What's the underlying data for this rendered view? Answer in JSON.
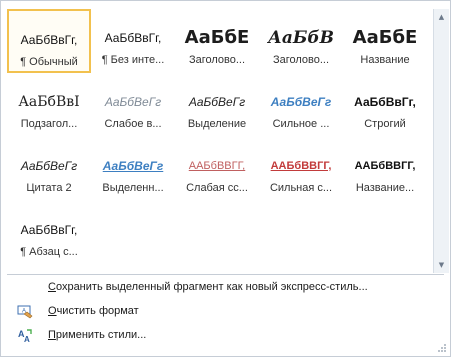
{
  "styles": [
    {
      "sample": "АаБбВвГг,",
      "caption": "¶ Обычный",
      "font": "\"Liberation Sans\", sans-serif",
      "size": "12px",
      "weight": "normal",
      "style": "normal",
      "color": "#111111",
      "decor": "none",
      "selected": true
    },
    {
      "sample": "АаБбВвГг,",
      "caption": "¶ Без инте...",
      "font": "\"Liberation Sans\", sans-serif",
      "size": "12px",
      "weight": "normal",
      "style": "normal",
      "color": "#111111",
      "decor": "none",
      "selected": false
    },
    {
      "sample": "АаБбЕ",
      "caption": "Заголово...",
      "font": "\"DejaVu Sans\", sans-serif",
      "size": "18px",
      "weight": "bold",
      "style": "normal",
      "color": "#1d1d1d",
      "decor": "none",
      "selected": false
    },
    {
      "sample": "АаБбВ",
      "caption": "Заголово...",
      "font": "\"DejaVu Serif\", serif",
      "size": "17px",
      "weight": "bold",
      "style": "italic",
      "color": "#1d1d1d",
      "decor": "none",
      "selected": false
    },
    {
      "sample": "АаБбЕ",
      "caption": "Название",
      "font": "\"DejaVu Sans\", sans-serif",
      "size": "18px",
      "weight": "bold",
      "style": "normal",
      "color": "#1d1d1d",
      "decor": "none",
      "selected": false
    },
    {
      "sample": "АаБбВвI",
      "caption": "Подзагол...",
      "font": "\"DejaVu Serif\", serif",
      "size": "14px",
      "weight": "normal",
      "style": "normal",
      "color": "#222222",
      "decor": "none",
      "selected": false
    },
    {
      "sample": "АаБбВеГг",
      "caption": "Слабое в...",
      "font": "\"Liberation Sans\", sans-serif",
      "size": "12px",
      "weight": "normal",
      "style": "italic",
      "color": "#7f8a96",
      "decor": "none",
      "selected": false
    },
    {
      "sample": "АаБбВеГг",
      "caption": "Выделение",
      "font": "\"Liberation Sans\", sans-serif",
      "size": "12px",
      "weight": "normal",
      "style": "italic",
      "color": "#222222",
      "decor": "none",
      "selected": false
    },
    {
      "sample": "АаБбВеГг",
      "caption": "Сильное ...",
      "font": "\"Liberation Sans\", sans-serif",
      "size": "12px",
      "weight": "bold",
      "style": "italic",
      "color": "#3d7fc1",
      "decor": "none",
      "selected": false
    },
    {
      "sample": "АаБбВвГг,",
      "caption": "Строгий",
      "font": "\"Liberation Sans\", sans-serif",
      "size": "12px",
      "weight": "bold",
      "style": "normal",
      "color": "#111111",
      "decor": "none",
      "selected": false
    },
    {
      "sample": "АаБбВеГг",
      "caption": "Цитата 2",
      "font": "\"Liberation Sans\", sans-serif",
      "size": "12px",
      "weight": "normal",
      "style": "italic",
      "color": "#1d1d1d",
      "decor": "none",
      "selected": false
    },
    {
      "sample": "АаБбВеГг",
      "caption": "Выделенн...",
      "font": "\"Liberation Sans\", sans-serif",
      "size": "12px",
      "weight": "bold",
      "style": "italic",
      "color": "#3d7fc1",
      "decor": "underline",
      "selected": false
    },
    {
      "sample": "ААБбВВГГ,",
      "caption": "Слабая сс...",
      "font": "\"Liberation Sans\", sans-serif",
      "size": "11px",
      "weight": "normal",
      "style": "normal",
      "color": "#c06060",
      "decor": "underline",
      "selected": false
    },
    {
      "sample": "ААБбВВГГ,",
      "caption": "Сильная с...",
      "font": "\"Liberation Sans\", sans-serif",
      "size": "11px",
      "weight": "bold",
      "style": "normal",
      "color": "#c23b3b",
      "decor": "underline",
      "selected": false
    },
    {
      "sample": "ААБбВВГГ,",
      "caption": "Название...",
      "font": "\"Liberation Sans\", sans-serif",
      "size": "11px",
      "weight": "bold",
      "style": "normal",
      "color": "#111111",
      "decor": "none",
      "selected": false
    },
    {
      "sample": "АаБбВвГг,",
      "caption": "¶ Абзац с...",
      "font": "\"Liberation Sans\", sans-serif",
      "size": "12px",
      "weight": "normal",
      "style": "normal",
      "color": "#111111",
      "decor": "none",
      "selected": false
    }
  ],
  "menu": {
    "save_label": "Сохранить выделенный фрагмент как новый экспресс-стиль...",
    "clear_label": "Очистить формат",
    "apply_label": "Применить стили..."
  },
  "icons": {
    "scroll_up": "▲",
    "scroll_down": "▼",
    "clear_icon": "eraser-icon",
    "apply_icon": "apply-styles-icon"
  }
}
